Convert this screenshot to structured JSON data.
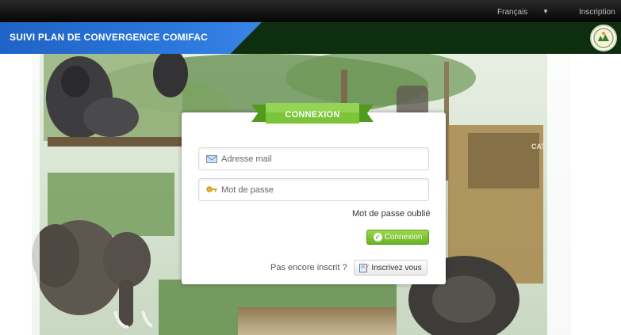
{
  "topbar": {
    "language": "Français",
    "language_arrow": "▼",
    "signup_link": "Inscription"
  },
  "header": {
    "title": "SUIVI PLAN DE CONVERGENCE COMIFAC",
    "logo_icon": "comifac-logo-icon"
  },
  "login": {
    "ribbon_label": "CONNEXION",
    "email_placeholder": "Adresse mail",
    "password_placeholder": "Mot de passe",
    "forgot_password": "Mot de passe oublié",
    "connect_button": "Connexion",
    "not_registered": "Pas encore inscrit ?",
    "signup_button": "Inscrivez vous"
  },
  "colors": {
    "header_blue": "#2c78dc",
    "header_green": "#0d2f10",
    "accent_green": "#66b324"
  },
  "icons": [
    "envelope-icon",
    "key-icon",
    "check-icon",
    "edit-icon",
    "comifac-logo-icon"
  ]
}
